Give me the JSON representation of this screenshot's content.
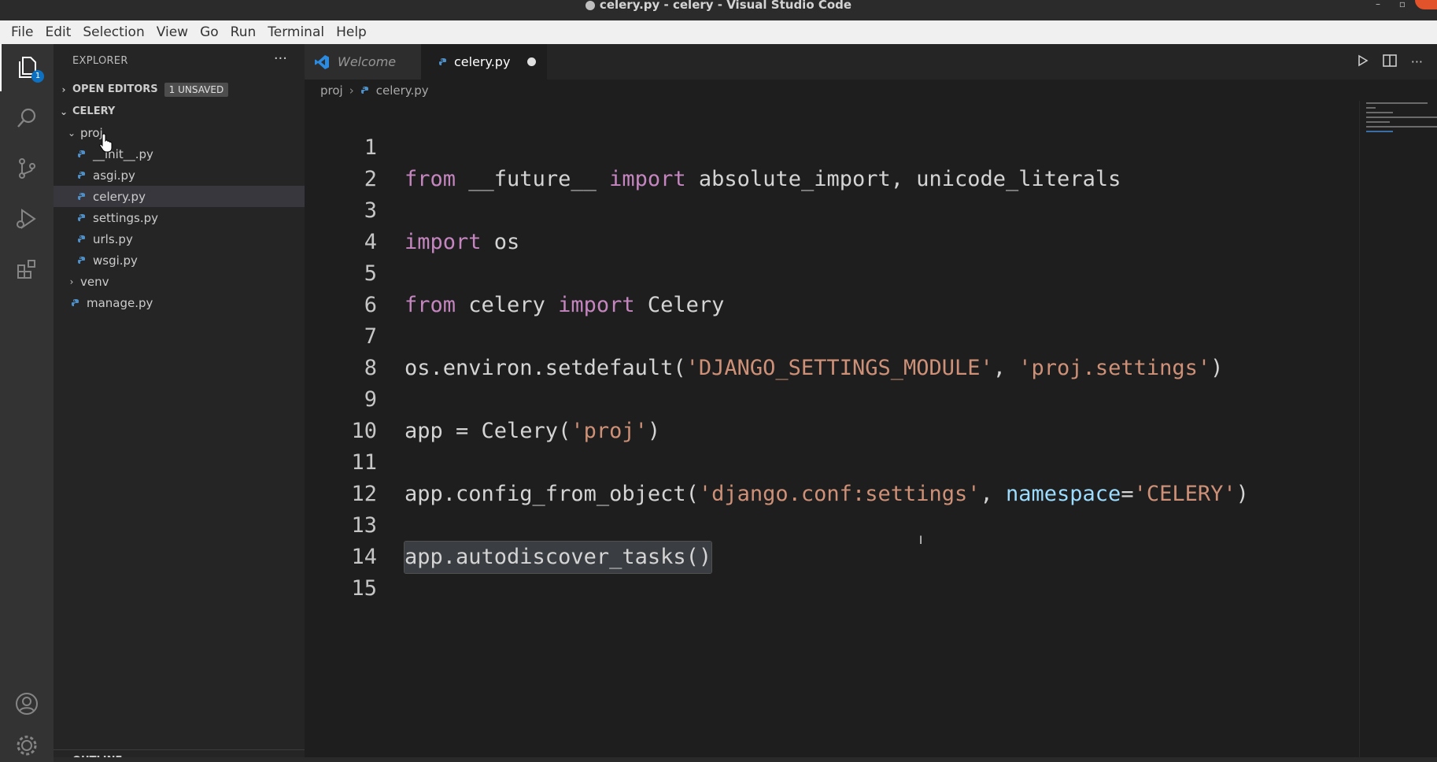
{
  "window": {
    "title": "celery.py - celery - Visual Studio Code"
  },
  "menu": [
    "File",
    "Edit",
    "Selection",
    "View",
    "Go",
    "Run",
    "Terminal",
    "Help"
  ],
  "activity_bar": {
    "explorer_badge": "1",
    "icons": [
      "files-icon",
      "search-icon",
      "source-control-icon",
      "run-debug-icon",
      "extensions-icon",
      "account-icon",
      "settings-gear-icon"
    ]
  },
  "sidebar": {
    "header": "EXPLORER",
    "more": "···",
    "open_editors": {
      "label": "OPEN EDITORS",
      "badge": "1 UNSAVED"
    },
    "workspace": {
      "label": "CELERY",
      "folder": "proj",
      "files": [
        "__init__.py",
        "asgi.py",
        "celery.py",
        "settings.py",
        "urls.py",
        "wsgi.py"
      ],
      "selected": "celery.py",
      "venv": "venv",
      "manage": "manage.py"
    },
    "outline": "OUTLINE"
  },
  "tabs": [
    {
      "label": "Welcome",
      "active": false
    },
    {
      "label": "celery.py",
      "active": true,
      "modified": true
    }
  ],
  "breadcrumb": {
    "folder": "proj",
    "file": "celery.py"
  },
  "editor": {
    "line_numbers": [
      "1",
      "2",
      "3",
      "4",
      "5",
      "6",
      "7",
      "8",
      "9",
      "10",
      "11",
      "12",
      "13",
      "14",
      "15"
    ],
    "lines": [
      "from __future__ import absolute_import, unicode_literals",
      "",
      "import os",
      "",
      "from celery import Celery",
      "",
      "os.environ.setdefault('DJANGO_SETTINGS_MODULE', 'proj.settings')",
      "",
      "app = Celery('proj')",
      "",
      "app.config_from_object('django.conf:settings', namespace='CELERY')",
      "",
      "app.autodiscover_tasks()",
      "",
      ""
    ]
  },
  "colors": {
    "keyword": "#c586c0",
    "function": "#dcdcaa",
    "string": "#ce9178",
    "variable": "#9cdcfe",
    "accent": "#0e70c0"
  }
}
